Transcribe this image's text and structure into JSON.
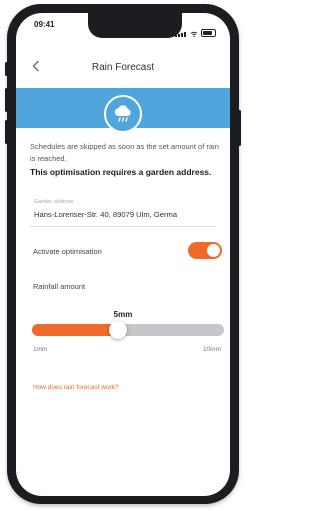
{
  "status_bar": {
    "time": "09:41"
  },
  "header": {
    "title": "Rain Forecast",
    "back_icon": "chevron-left-icon"
  },
  "hero": {
    "icon": "cloud-rain-icon",
    "color": "#4fa5dc"
  },
  "content": {
    "description": "Schedules are skipped as soon as the set amount of rain is reached.",
    "notice": "This optimisation requires a garden address.",
    "address": {
      "label": "Garden address",
      "value": "Hans-Lorenser-Str. 40, 89079 Ulm, Germa"
    },
    "optimisation": {
      "label": "Activate optimisation",
      "enabled": true
    },
    "rainfall": {
      "label": "Rainfall amount",
      "value_text": "5mm",
      "value": 5,
      "min": 1,
      "max": 10,
      "min_label": "1mm",
      "max_label": "10mm"
    },
    "help_link": "How does rain forecast work?"
  },
  "colors": {
    "accent": "#ed6a2b",
    "hero": "#4fa5dc",
    "track": "#c6c7cb"
  }
}
